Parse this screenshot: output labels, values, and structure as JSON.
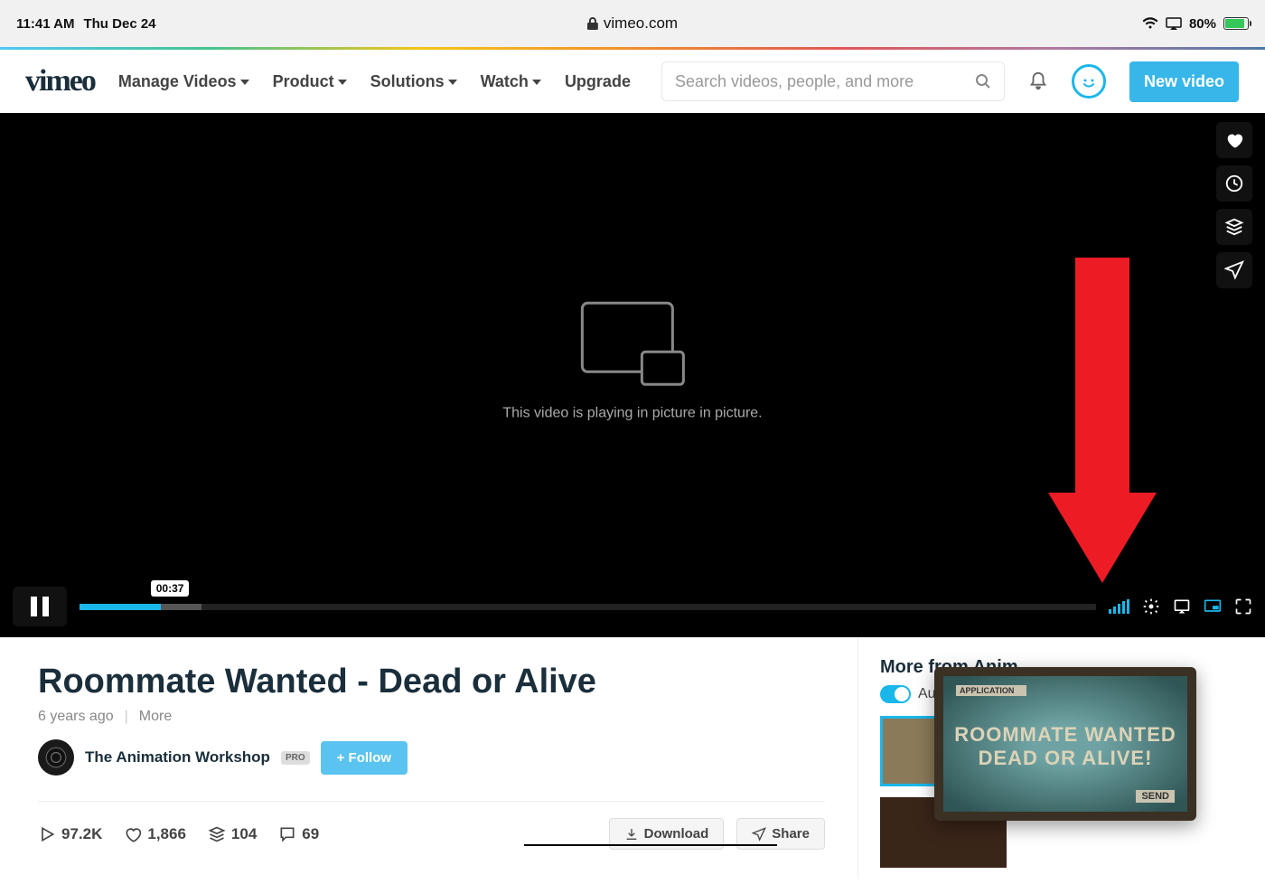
{
  "statusbar": {
    "time": "11:41 AM",
    "date": "Thu Dec 24",
    "domain": "vimeo.com",
    "battery_pct": "80%"
  },
  "header": {
    "logo": "vimeo",
    "nav": {
      "manage": "Manage Videos",
      "product": "Product",
      "solutions": "Solutions",
      "watch": "Watch",
      "upgrade": "Upgrade"
    },
    "search_placeholder": "Search videos, people, and more",
    "new_video": "New video"
  },
  "player": {
    "pip_message": "This video is playing in picture in picture.",
    "time_tooltip": "00:37"
  },
  "video": {
    "title": "Roommate Wanted - Dead or Alive",
    "age": "6 years ago",
    "more": "More",
    "author": "The Animation Workshop",
    "pro_badge": "PRO",
    "follow": "+  Follow",
    "stats": {
      "plays": "97.2K",
      "likes": "1,866",
      "collections": "104",
      "comments": "69"
    },
    "download": "Download",
    "share": "Share"
  },
  "sidebar": {
    "heading": "More from Anim",
    "autoplay": "Autoplay next"
  },
  "pip_float": {
    "app_label": "APPLICATION",
    "line1": "ROOMMATE WANTED",
    "line2": "DEAD  OR  ALIVE!",
    "send": "SEND"
  }
}
